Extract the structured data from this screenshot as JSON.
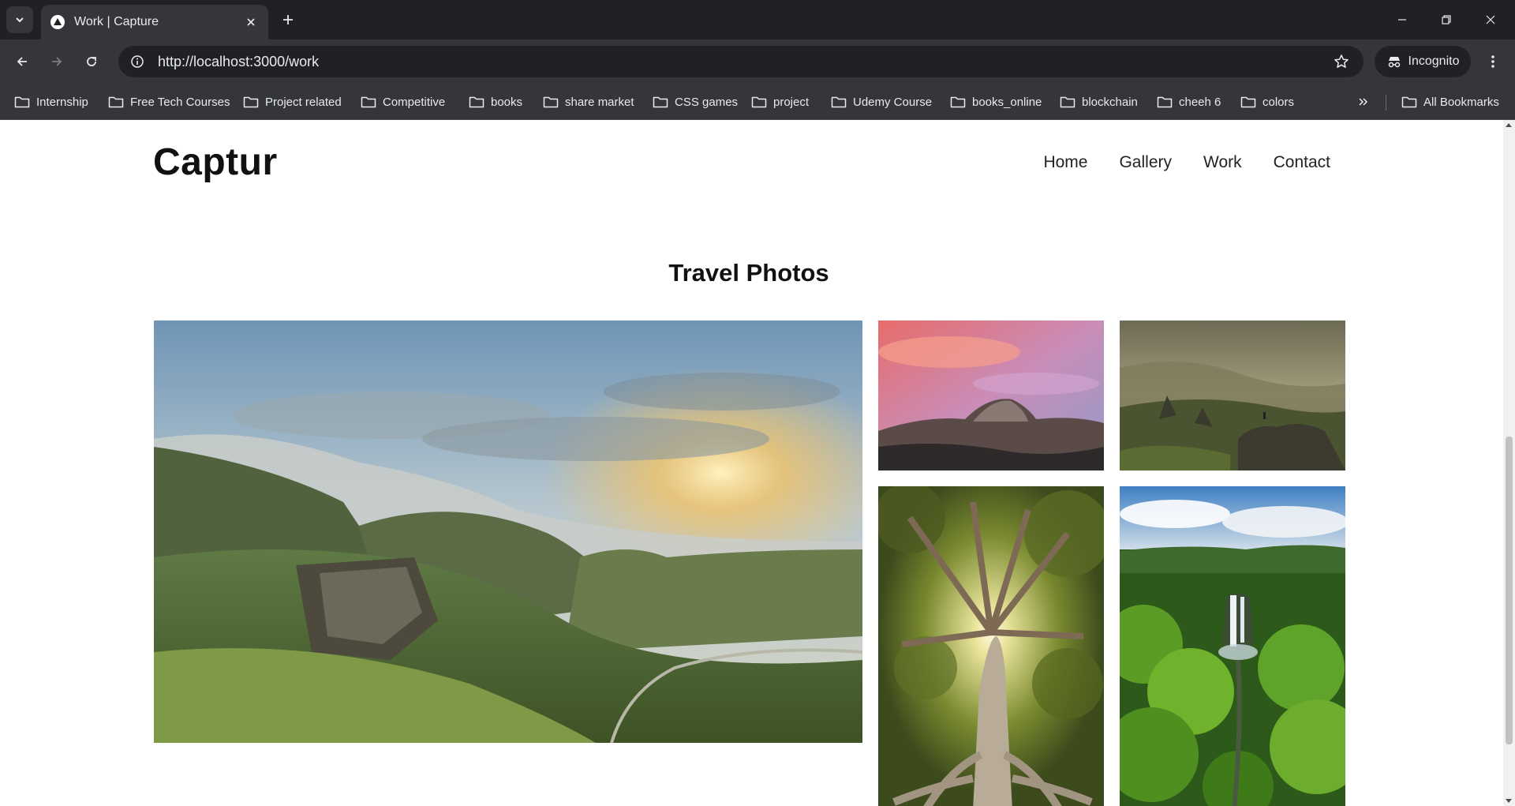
{
  "browser": {
    "tab_title": "Work | Capture",
    "url": "http://localhost:3000/work",
    "incognito_label": "Incognito",
    "bookmarks": [
      "Internship",
      "Free Tech Courses",
      "Project related",
      "Competitive",
      "books",
      "share market",
      "CSS games",
      "project",
      "Udemy Course",
      "books_online",
      "blockchain",
      "cheeh 6",
      "colors"
    ],
    "all_bookmarks_label": "All Bookmarks"
  },
  "site": {
    "logo": "Captur",
    "nav": [
      "Home",
      "Gallery",
      "Work",
      "Contact"
    ]
  },
  "gallery": {
    "title": "Travel Photos",
    "photos": [
      {
        "subject": "misty green valley with sunrise"
      },
      {
        "subject": "pink sunset over granite dome"
      },
      {
        "subject": "hiker on rocky cliff over valley"
      },
      {
        "subject": "large tree with sunburst through branches"
      },
      {
        "subject": "aerial waterfall in rainforest"
      }
    ]
  },
  "colors": {
    "chrome_dark": "#202124",
    "chrome_mid": "#35363a",
    "chrome_text": "#e8eaed",
    "page_text": "#111111"
  }
}
